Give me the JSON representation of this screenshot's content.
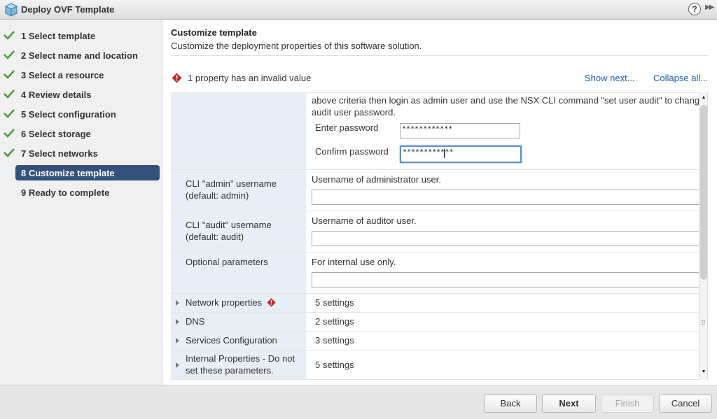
{
  "window": {
    "title": "Deploy OVF Template",
    "help_label": "?",
    "expand_label": "▶▶"
  },
  "steps": [
    {
      "label": "1 Select template",
      "done": true
    },
    {
      "label": "2 Select name and location",
      "done": true
    },
    {
      "label": "3 Select a resource",
      "done": true
    },
    {
      "label": "4 Review details",
      "done": true
    },
    {
      "label": "5 Select configuration",
      "done": true
    },
    {
      "label": "6 Select storage",
      "done": true
    },
    {
      "label": "7 Select networks",
      "done": true
    },
    {
      "label": "8 Customize template",
      "active": true
    },
    {
      "label": "9 Ready to complete"
    }
  ],
  "main": {
    "title": "Customize template",
    "description": "Customize the deployment properties of this software solution.",
    "warning": "1 property has an invalid value",
    "show_next": "Show next...",
    "collapse_all": "Collapse all..."
  },
  "properties": {
    "audit_pw_text_line1": "above criteria then login as admin user and use the NSX CLI command \"set user audit\" to change",
    "audit_pw_text_line2": "audit user password.",
    "enter_password_label": "Enter password",
    "enter_password_value": "************",
    "confirm_password_label": "Confirm password",
    "confirm_password_value": "************",
    "cli_admin_label": "CLI \"admin\" username (default: admin)",
    "cli_admin_desc": "Username of administrator user.",
    "cli_admin_value": "",
    "cli_audit_label": "CLI \"audit\" username (default: audit)",
    "cli_audit_desc": "Username of auditor user.",
    "cli_audit_value": "",
    "optional_label": "Optional parameters",
    "optional_desc": "For internal use only.",
    "optional_value": ""
  },
  "groups": [
    {
      "label": "Network properties",
      "value": "5 settings",
      "invalid": true
    },
    {
      "label": "DNS",
      "value": "2 settings"
    },
    {
      "label": "Services Configuration",
      "value": "3 settings"
    },
    {
      "label": "Internal Properties - Do not set these parameters.",
      "value": "5 settings"
    }
  ],
  "buttons": {
    "back": "Back",
    "next": "Next",
    "finish": "Finish",
    "cancel": "Cancel"
  },
  "colors": {
    "active_step_bg": "#33517a",
    "link": "#1a5fb4",
    "check": "#4a9a3a",
    "warning": "#c0272d",
    "label_col_bg": "#e8eef5"
  }
}
